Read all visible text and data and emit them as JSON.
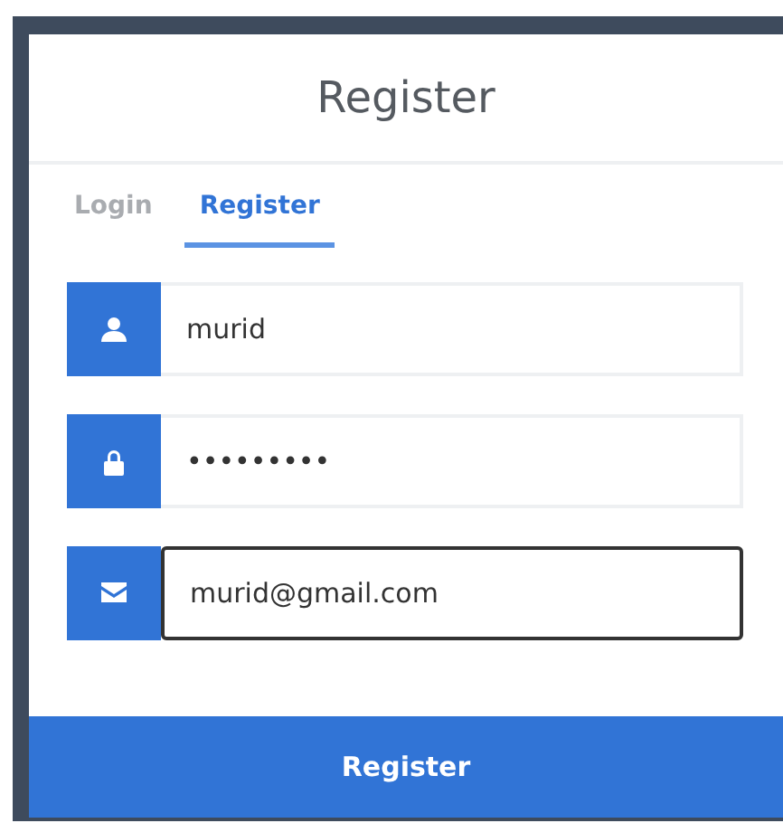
{
  "title": "Register",
  "tabs": [
    {
      "label": "Login",
      "selected": false
    },
    {
      "label": "Register",
      "selected": true
    }
  ],
  "fields": [
    {
      "kind": "user",
      "value": "murid",
      "focused": false
    },
    {
      "kind": "lock",
      "value": "•••••••••",
      "focused": false
    },
    {
      "kind": "mail",
      "value": "murid@gmail.com",
      "focused": true
    }
  ],
  "submit": "Register"
}
